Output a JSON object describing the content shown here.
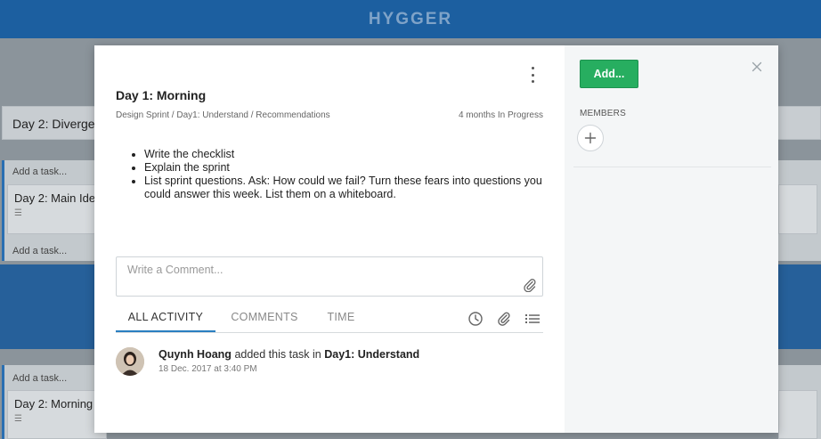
{
  "app": {
    "brand": "HYGGER"
  },
  "board": {
    "lanes": [
      {
        "label": "Day 2: Diverge"
      }
    ],
    "add_task_label": "Add a task...",
    "cards": [
      {
        "label": "Day 2: Main Idea"
      },
      {
        "label": "Day 2: Morning"
      }
    ]
  },
  "task": {
    "title": "Day 1: Morning",
    "breadcrumb": "Design Sprint / Day1: Understand / Recommendations",
    "status": "4 months In Progress",
    "checklist": [
      "Write the checklist",
      "Explain the sprint",
      "List sprint questions. Ask: How could we fail? Turn these fears into questions you could answer this week. List them on a whiteboard."
    ]
  },
  "comment": {
    "placeholder": "Write a Comment..."
  },
  "tabs": [
    {
      "label": "ALL ACTIVITY",
      "active": true
    },
    {
      "label": "COMMENTS",
      "active": false
    },
    {
      "label": "TIME",
      "active": false
    }
  ],
  "activity": {
    "user": "Quynh Hoang",
    "action": "added this task in",
    "target": "Day1: Understand",
    "time": "18 Dec. 2017 at 3:40 PM"
  },
  "side": {
    "add_button_label": "Add...",
    "members_label": "MEMBERS"
  },
  "icons": {
    "menu": "kebab-menu-icon",
    "close": "close-icon",
    "attach": "paperclip-icon",
    "clock": "clock-icon",
    "list": "list-icon",
    "add_member": "plus-icon"
  },
  "colors": {
    "topbar": "#1c5fa0",
    "add_button": "#27ae60",
    "active_tab": "#2a7fc1"
  }
}
